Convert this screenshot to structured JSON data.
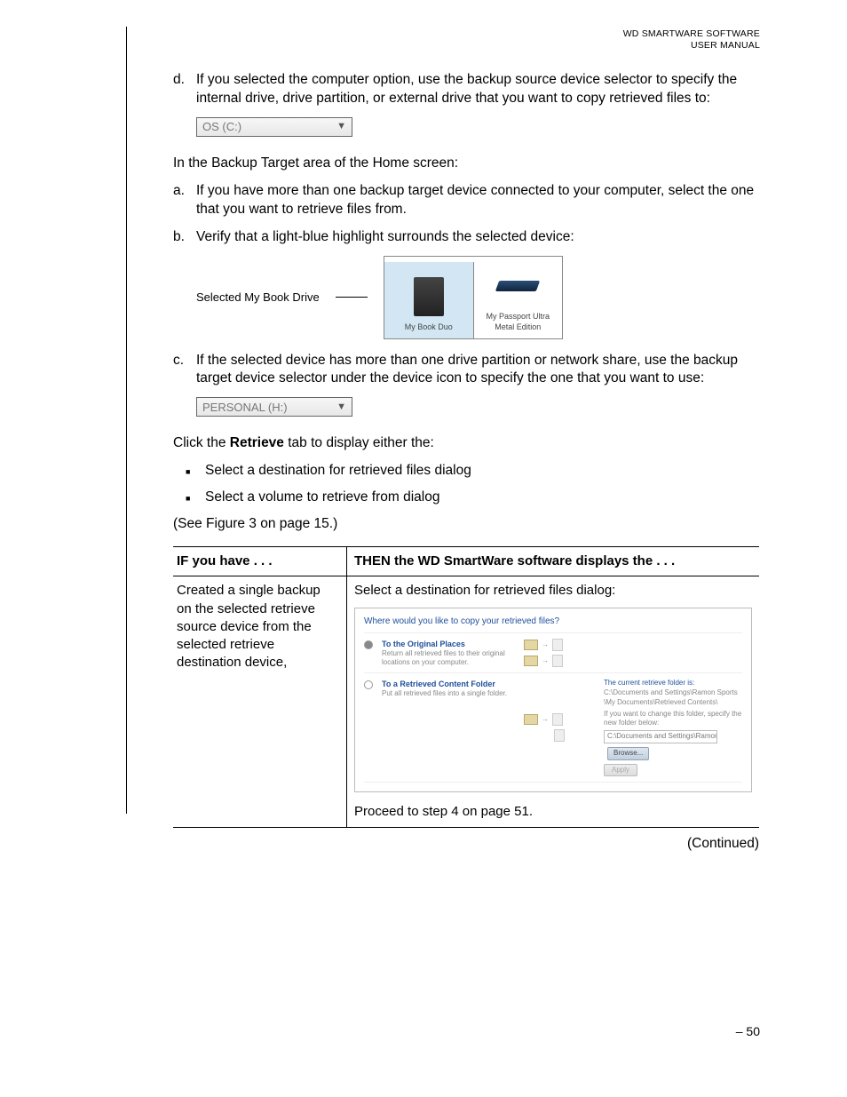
{
  "header": {
    "line1": "WD SMARTWARE SOFTWARE",
    "line2": "USER MANUAL"
  },
  "steps": {
    "d": {
      "label": "d.",
      "text": "If you selected the computer option, use the backup source device selector to specify the internal drive, drive partition, or external drive that you want to copy retrieved files to:"
    },
    "dropdown1": "OS (C:)",
    "target_intro": "In the Backup Target area of the Home screen:",
    "a": {
      "label": "a.",
      "text": "If you have more than one backup target device connected to your computer, select the one that you want to retrieve files from."
    },
    "b": {
      "label": "b.",
      "text": "Verify that a light-blue highlight surrounds the selected device:"
    },
    "callout": "Selected My Book Drive",
    "device1": "My Book Duo",
    "device2a": "My Passport Ultra",
    "device2b": "Metal Edition",
    "c": {
      "label": "c.",
      "text": "If the selected device has more than one drive partition or network share, use the backup target device selector under the device icon to specify the one that you want to use:"
    },
    "dropdown2": "PERSONAL (H:)",
    "click_prefix": "Click the ",
    "click_bold": "Retrieve",
    "click_suffix": " tab to display either the:",
    "bullet1": "Select a destination for retrieved files dialog",
    "bullet2": "Select a volume to retrieve from dialog",
    "see_figure": "(See Figure 3 on page 15.)"
  },
  "table": {
    "h1": "IF you have . . .",
    "h2": "THEN the WD SmartWare software displays the . . .",
    "r1c1_l1": "Created a single backup",
    "r1c1_l2": "on the selected retrieve",
    "r1c1_l3_a": "source device ",
    "r1c1_l3_b": "from the",
    "r1c1_l4": "selected retrieve",
    "r1c1_l5": "destination device,",
    "r1c2_top": "Select a destination for retrieved files dialog:",
    "r1c2_bottom": "Proceed to step 4 on page 51."
  },
  "screenshot": {
    "title": "Where would you like to copy your retrieved files?",
    "opt1_h": "To the Original Places",
    "opt1_t": "Return all retrieved files to their original locations on your computer.",
    "opt2_h": "To a Retrieved Content Folder",
    "opt2_t": "Put all retrieved files into a single folder.",
    "aside1": "The current retrieve folder is:",
    "aside2": "C:\\Documents and Settings\\Ramon Sports\\My Documents\\Retrieved Contents\\",
    "aside3": "If you want to change this folder, specify the new folder below:",
    "path": "C:\\Documents and Settings\\Ramon",
    "browse": "Browse...",
    "apply": "Apply"
  },
  "continued": "(Continued)",
  "page_number": "– 50"
}
